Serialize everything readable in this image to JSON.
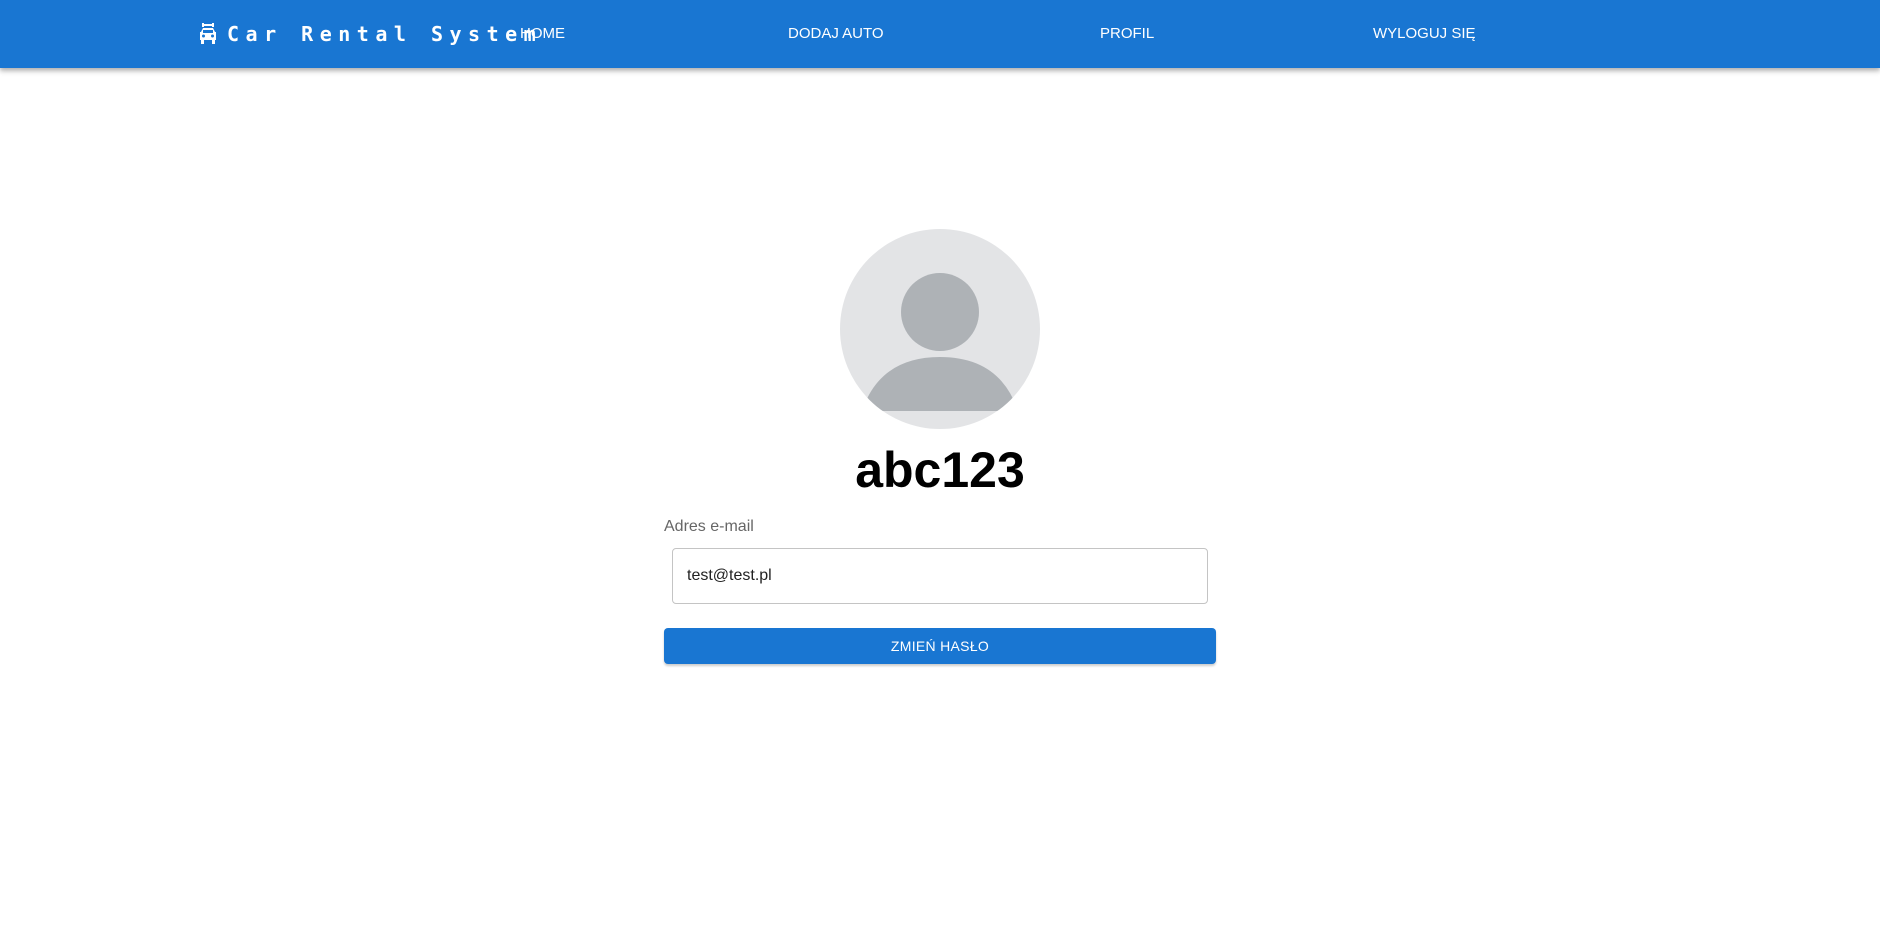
{
  "app": {
    "title": "Car Rental System",
    "brand_icon": "car-front-icon"
  },
  "nav": {
    "items": [
      {
        "label": "HOME"
      },
      {
        "label": "DODAJ AUTO"
      },
      {
        "label": "PROFIL"
      },
      {
        "label": "WYLOGUJ SIĘ"
      }
    ]
  },
  "profile": {
    "avatar_icon": "person-placeholder-icon",
    "username": "abc123",
    "email_label": "Adres e-mail",
    "email_value": "test@test.pl",
    "change_password_label": "ZMIEŃ HASŁO"
  },
  "colors": {
    "primary": "#1976d2",
    "avatar_bg": "#e3e4e6",
    "avatar_fg": "#aeb2b6"
  }
}
